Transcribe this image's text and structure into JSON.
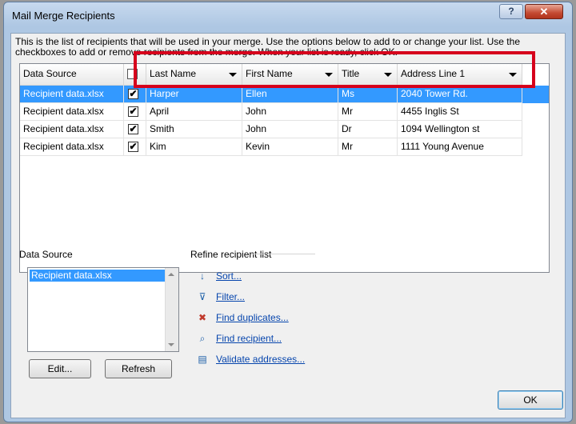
{
  "window": {
    "title": "Mail Merge Recipients",
    "help_label": "?",
    "close_label": "✕"
  },
  "description": "This is the list of recipients that will be used in your merge.  Use the options below to add to or change your list.  Use the checkboxes to add or remove recipients from the merge.  When your list is ready, click OK.",
  "grid": {
    "columns": [
      "Data Source",
      "",
      "Last Name",
      "First Name",
      "Title",
      "Address Line 1"
    ],
    "rows": [
      {
        "source": "Recipient data.xlsx",
        "checked": true,
        "last": "Harper",
        "first": "Ellen",
        "title": "Ms",
        "address": "2040 Tower Rd.",
        "selected": true
      },
      {
        "source": "Recipient data.xlsx",
        "checked": true,
        "last": "April",
        "first": "John",
        "title": "Mr",
        "address": "4455 Inglis St",
        "selected": false
      },
      {
        "source": "Recipient data.xlsx",
        "checked": true,
        "last": "Smith",
        "first": "John",
        "title": "Dr",
        "address": "1094 Wellington st",
        "selected": false
      },
      {
        "source": "Recipient data.xlsx",
        "checked": true,
        "last": "Kim",
        "first": "Kevin",
        "title": "Mr",
        "address": "1111 Young Avenue",
        "selected": false
      }
    ],
    "check_glyph": "✔"
  },
  "data_source_panel": {
    "label": "Data Source",
    "items": [
      "Recipient data.xlsx"
    ],
    "edit_label": "Edit...",
    "refresh_label": "Refresh"
  },
  "refine": {
    "label": "Refine recipient list",
    "links": [
      {
        "icon": "sort-icon",
        "glyph": "↓",
        "label": "Sort..."
      },
      {
        "icon": "filter-icon",
        "glyph": "⊽",
        "label": "Filter..."
      },
      {
        "icon": "find-duplicates-icon",
        "glyph": "✖",
        "label": "Find duplicates..."
      },
      {
        "icon": "find-recipient-icon",
        "glyph": "⌕",
        "label": "Find recipient..."
      },
      {
        "icon": "validate-addresses-icon",
        "glyph": "▤",
        "label": "Validate addresses..."
      }
    ]
  },
  "ok_label": "OK",
  "colors": {
    "selection": "#3399ff",
    "highlight_box": "#d6001c",
    "link": "#0645ad"
  }
}
